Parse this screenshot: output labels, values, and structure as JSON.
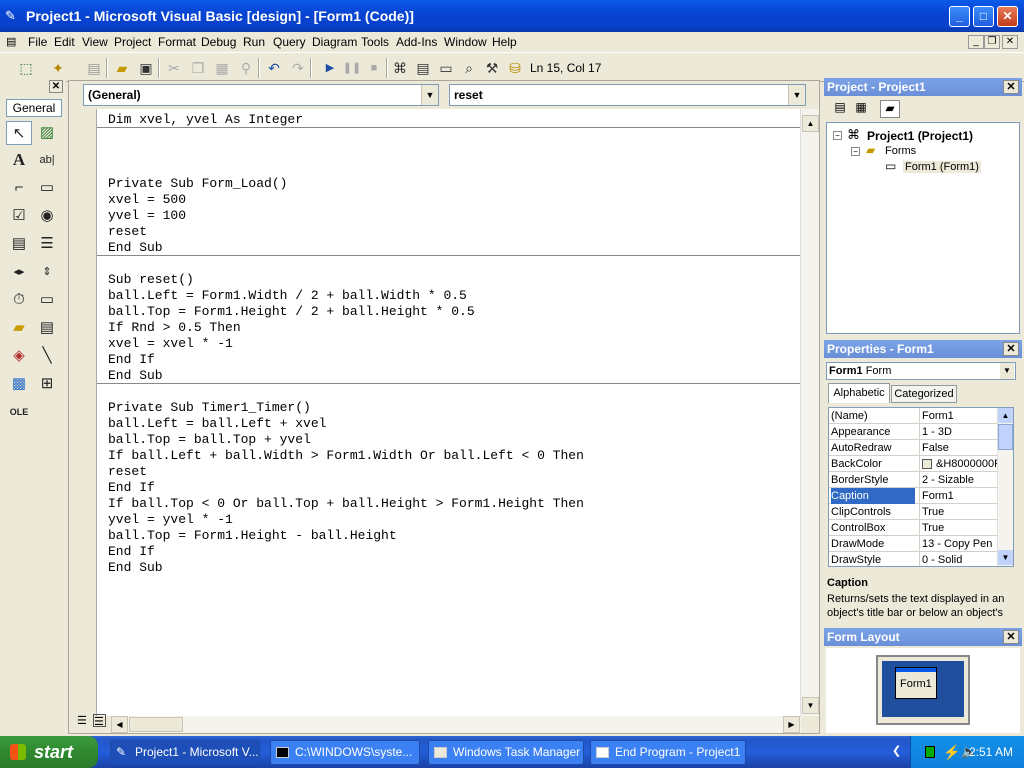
{
  "titlebar": {
    "title": "Project1 - Microsoft Visual Basic [design] - [Form1 (Code)]",
    "min": "_",
    "max": "□",
    "close": "✕"
  },
  "menu": [
    "File",
    "Edit",
    "View",
    "Project",
    "Format",
    "Debug",
    "Run",
    "Query",
    "Diagram",
    "Tools",
    "Add-Ins",
    "Window",
    "Help"
  ],
  "mdi": {
    "min": "_",
    "restore": "❐",
    "close": "✕"
  },
  "toolbar": {
    "position": "Ln 15, Col 17"
  },
  "toolbox": {
    "tab": "General"
  },
  "code": {
    "object_combo": "(General)",
    "proc_combo": "reset",
    "blocks": [
      "Dim xvel, yvel As Integer",
      "\n\n\nPrivate Sub Form_Load()\nxvel = 500\nyvel = 100\nreset\nEnd Sub",
      "Sub reset()\nball.Left = Form1.Width / 2 + ball.Width * 0.5\nball.Top = Form1.Height / 2 + ball.Height * 0.5\nIf Rnd > 0.5 Then\nxvel = xvel * -1\nEnd If\nEnd Sub",
      "Private Sub Timer1_Timer()\nball.Left = ball.Left + xvel\nball.Top = ball.Top + yvel\nIf ball.Left + ball.Width > Form1.Width Or ball.Left < 0 Then\nreset\nEnd If\nIf ball.Top < 0 Or ball.Top + ball.Height > Form1.Height Then\nyvel = yvel * -1\nball.Top = Form1.Height - ball.Height\nEnd If\nEnd Sub"
    ]
  },
  "project": {
    "title": "Project - Project1",
    "root": "Project1 (Project1)",
    "folder": "Forms",
    "item": "Form1 (Form1)"
  },
  "properties": {
    "title": "Properties - Form1",
    "object_name": "Form1",
    "object_type": "Form",
    "tab_alpha": "Alphabetic",
    "tab_cat": "Categorized",
    "rows": [
      {
        "k": "(Name)",
        "v": "Form1"
      },
      {
        "k": "Appearance",
        "v": "1 - 3D"
      },
      {
        "k": "AutoRedraw",
        "v": "False"
      },
      {
        "k": "BackColor",
        "v": "&H8000000F"
      },
      {
        "k": "BorderStyle",
        "v": "2 - Sizable"
      },
      {
        "k": "Caption",
        "v": "Form1"
      },
      {
        "k": "ClipControls",
        "v": "True"
      },
      {
        "k": "ControlBox",
        "v": "True"
      },
      {
        "k": "DrawMode",
        "v": "13 - Copy Pen"
      },
      {
        "k": "DrawStyle",
        "v": "0 - Solid"
      }
    ],
    "desc_title": "Caption",
    "desc_text": "Returns/sets the text displayed in an object's title bar or below an object's"
  },
  "form_layout": {
    "title": "Form Layout",
    "form_label": "Form1"
  },
  "taskbar": {
    "start": "start",
    "tasks": [
      "Project1 - Microsoft V...",
      "C:\\WINDOWS\\syste...",
      "Windows Task Manager",
      "End Program - Project1"
    ],
    "clock": "2:51 AM"
  },
  "colors": {
    "xp_blue": "#0a5ae8",
    "panel_title": "#7ba2e7",
    "selection": "#316ac5",
    "desktop_blue": "#1f4e9c"
  }
}
